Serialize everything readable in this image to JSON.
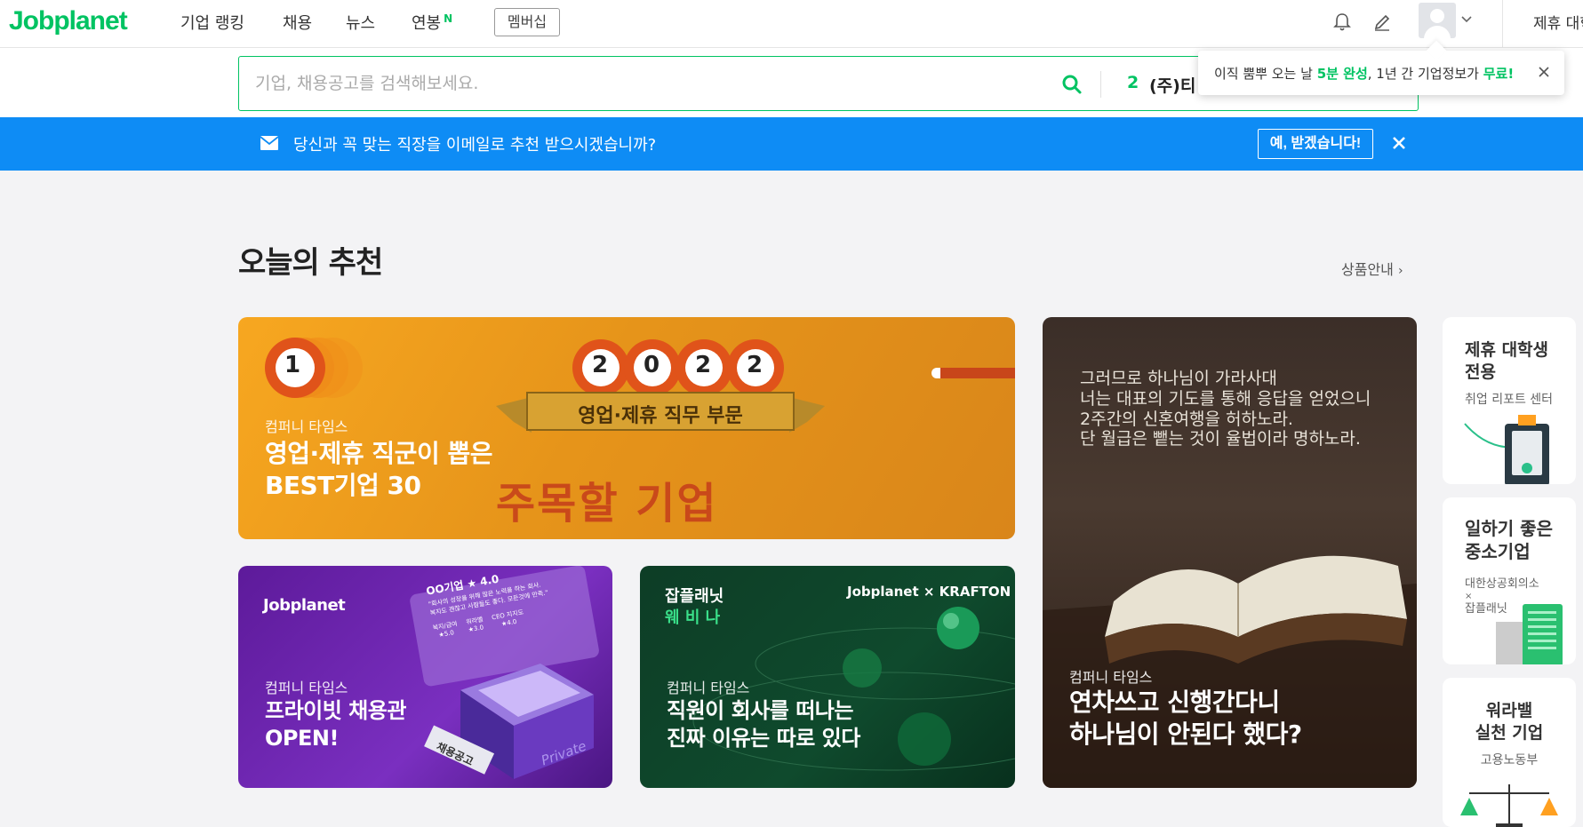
{
  "nav": {
    "logo": "Jobplanet",
    "items": [
      "기업 랭킹",
      "채용",
      "뉴스",
      "연봉"
    ],
    "new_badge": "N",
    "membership": "멤버십",
    "partner": "제휴 대학"
  },
  "search": {
    "placeholder": "기업, 채용공고를 검색해보세요.",
    "rank_number": "2",
    "rank_company": "(주)티"
  },
  "tooltip": {
    "pre": "이직 뿜뿌 오는 날 ",
    "highlight1": "5분 완성",
    "mid": ", 1년 간 기업정보가 ",
    "highlight2": "무료!"
  },
  "banner": {
    "text": "당신과 꼭 맞는 직장을 이메일로 추천 받으시겠습니까?",
    "button": "예, 받겠습니다!"
  },
  "section": {
    "title": "오늘의 추천",
    "link": "상품안내"
  },
  "cards": [
    {
      "category": "컴퍼니 타임스",
      "title_lines": [
        "영업·제휴 직군이 뽑은",
        "BEST기업 30"
      ],
      "art_rank": "1",
      "art_year": [
        "2",
        "0",
        "2",
        "2"
      ],
      "art_ribbon": "영업·제휴 직무 부문",
      "art_headline": "주목할 기업"
    },
    {
      "category": "컴퍼니 타임스",
      "title_lines": [
        "연차쓰고 신행간다니",
        "하나님이 안된다 했다?"
      ],
      "quote_lines": [
        "그러므로 하나님이 가라사대",
        "너는 대표의 기도를 통해 응답을 얻었으니",
        "2주간의 신혼여행을 허하노라.",
        "단 월급은 뺕는 것이 율법이라 명하노라."
      ]
    },
    {
      "category": "컴퍼니 타임스",
      "title_lines": [
        "프라이빗 채용관",
        "OPEN!"
      ],
      "brand": "Jobplanet",
      "art_tag": "채용공고",
      "art_box": "Private",
      "art_card_title": "OO기업 ★ 4.0",
      "art_card_quote": "\"회사의 성장을 위해 많은 노력을 하는 회사.",
      "art_card_quote2": "복지도 괜찮고 사람들도 좋다. 모든것에 만족.\"",
      "art_ratings": [
        {
          "label": "복지/급여",
          "value": "★5.0"
        },
        {
          "label": "워라밸",
          "value": "★3.0"
        },
        {
          "label": "CEO 지지도",
          "value": "★4.0"
        }
      ]
    },
    {
      "category": "컴퍼니 타임스",
      "title_lines": [
        "직원이 회사를 떠나는",
        "진짜 이유는 따로 있다"
      ],
      "brand": "잡플래닛",
      "brand_sub": "웨 비 나",
      "partner": "Jobplanet × KRAFTON"
    }
  ],
  "side_cards": [
    {
      "title_lines": [
        "제휴 대학생",
        "전용"
      ],
      "sub": "취업 리포트 센터"
    },
    {
      "title_lines": [
        "일하기 좋은",
        "중소기업"
      ],
      "sub_lines": [
        "대한상공회의소",
        "×",
        "잡플래닛"
      ]
    },
    {
      "title_lines": [
        "워라밸",
        "실천 기업"
      ],
      "sub": "고용노동부"
    }
  ],
  "colors": {
    "brand_green": "#00c362",
    "banner_blue": "#0e8cf5"
  }
}
